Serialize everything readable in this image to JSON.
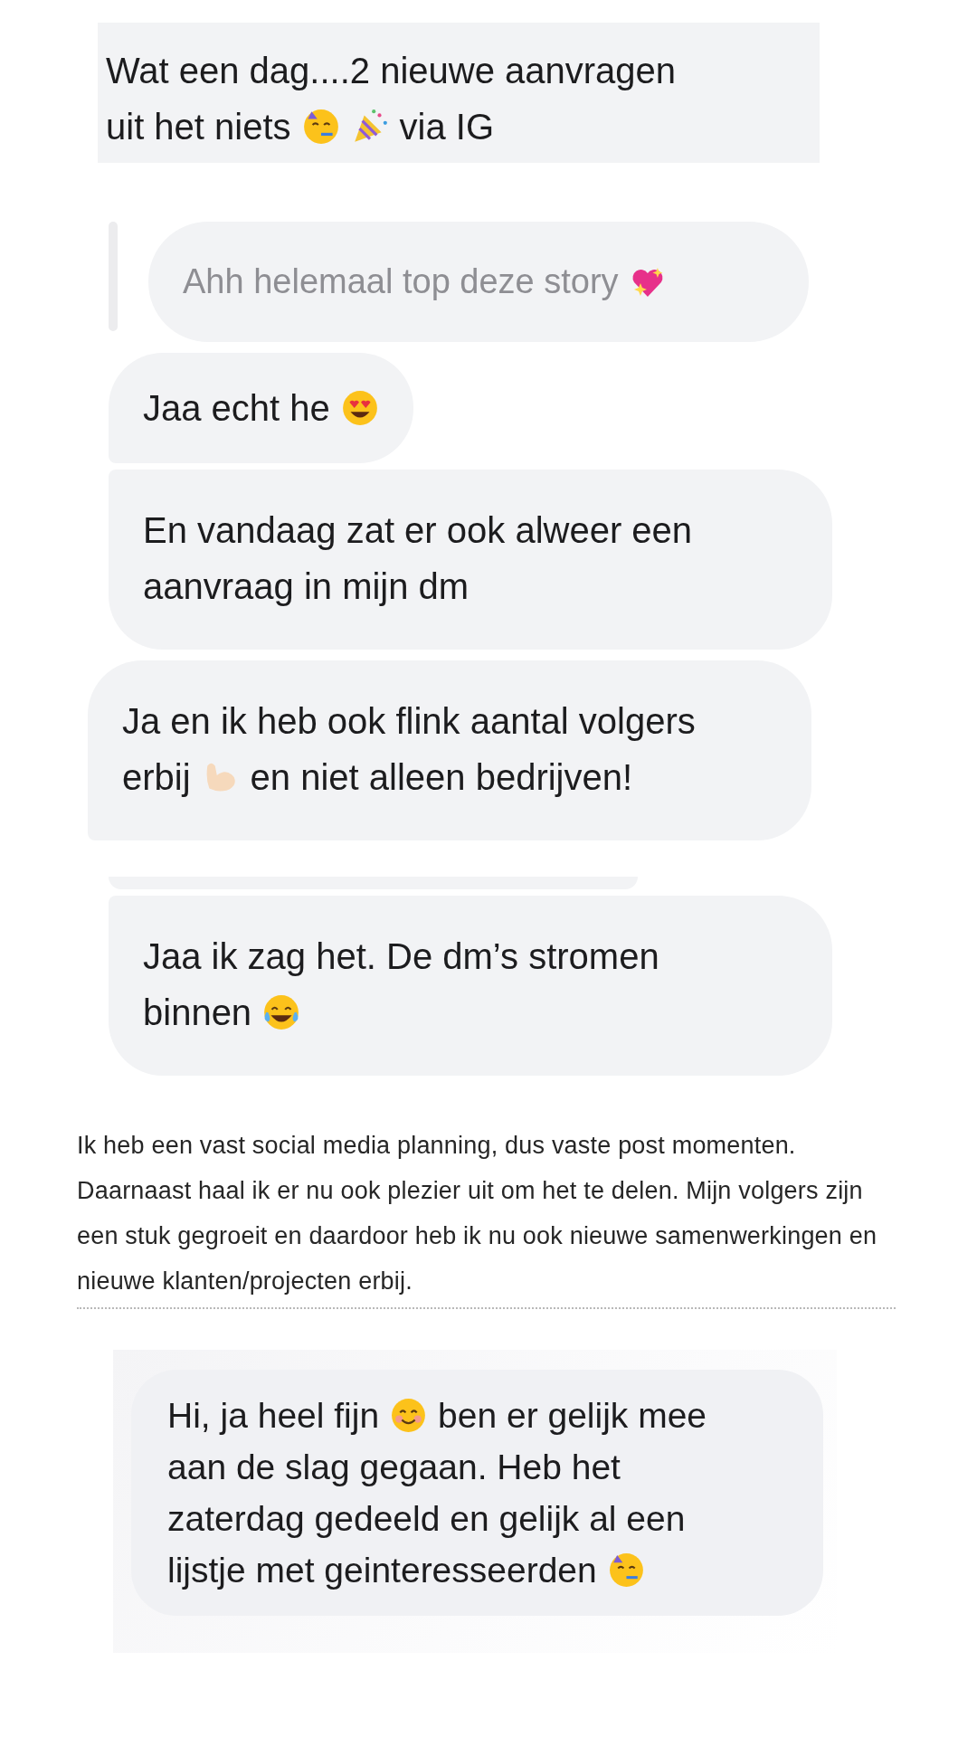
{
  "blocks": [
    {
      "kind": "snippet",
      "lines": [
        [
          {
            "kind": "text",
            "text": "Wat een dag....2 nieuwe aanvragen"
          }
        ],
        [
          {
            "kind": "text",
            "text": "uit het niets"
          },
          {
            "kind": "party_face"
          },
          {
            "kind": "party_popper"
          },
          {
            "kind": "text",
            "text": "via IG"
          }
        ]
      ]
    },
    {
      "kind": "quote",
      "lines": [
        [
          {
            "kind": "text",
            "text": "Ahh helemaal top deze story"
          },
          {
            "kind": "sparkling_heart"
          }
        ]
      ]
    },
    {
      "kind": "bubble",
      "grouped": false,
      "lines": [
        [
          {
            "kind": "text",
            "text": "Jaa echt he"
          },
          {
            "kind": "heart_eyes"
          }
        ]
      ]
    },
    {
      "kind": "bubble",
      "grouped": true,
      "lines": [
        [
          {
            "kind": "text",
            "text": "En vandaag zat er ook alweer een"
          }
        ],
        [
          {
            "kind": "text",
            "text": "aanvraag in mijn dm"
          }
        ]
      ]
    },
    {
      "kind": "bubble",
      "grouped": false,
      "lines": [
        [
          {
            "kind": "text",
            "text": "Ja en ik heb ook flink aantal volgers"
          }
        ],
        [
          {
            "kind": "text",
            "text": "erbij"
          },
          {
            "kind": "biceps"
          },
          {
            "kind": "text",
            "text": "en niet alleen bedrijven!"
          }
        ]
      ]
    },
    {
      "kind": "cut_bubble"
    },
    {
      "kind": "bubble",
      "grouped": true,
      "lines": [
        [
          {
            "kind": "text",
            "text": "Jaa ik zag het. De dm’s stromen"
          }
        ],
        [
          {
            "kind": "text",
            "text": "binnen"
          },
          {
            "kind": "tears_of_joy"
          }
        ]
      ]
    },
    {
      "kind": "paragraph",
      "text": "Ik heb een vast social media planning, dus vaste post momenten. Daarnaast haal ik er nu ook plezier uit om het te delen. Mijn volgers zijn een stuk gegroeit en daardoor heb ik nu ook nieuwe samenwerkingen en nieuwe klanten/projecten erbij."
    },
    {
      "kind": "framed_bubble",
      "lines": [
        [
          {
            "kind": "text",
            "text": "Hi, ja heel fijn"
          },
          {
            "kind": "smiling_face"
          },
          {
            "kind": "text",
            "text": "ben er gelijk mee"
          }
        ],
        [
          {
            "kind": "text",
            "text": "aan de slag gegaan. Heb het"
          }
        ],
        [
          {
            "kind": "text",
            "text": "zaterdag gedeeld en gelijk al een"
          }
        ],
        [
          {
            "kind": "text",
            "text": "lijstje met geinteresseerden"
          },
          {
            "kind": "party_face"
          }
        ]
      ]
    }
  ]
}
